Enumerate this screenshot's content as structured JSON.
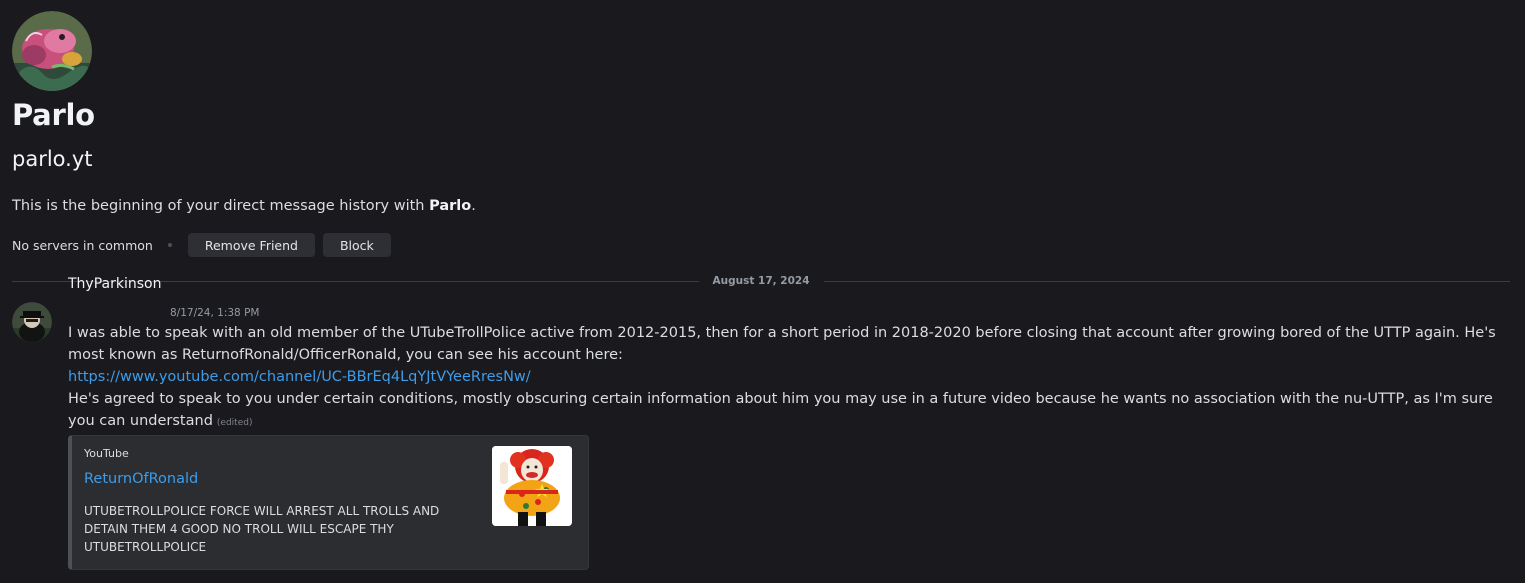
{
  "profile": {
    "display_name": "Parlo",
    "username": "parlo.yt",
    "intro_prefix": "This is the beginning of your direct message history with ",
    "intro_name": "Parlo",
    "intro_suffix": ".",
    "mutual_servers": "No servers in common",
    "remove_friend_label": "Remove Friend",
    "block_label": "Block"
  },
  "divider": {
    "date": "August 17, 2024"
  },
  "message": {
    "author": "ThyParkinson",
    "timestamp": "8/17/24, 1:38 PM",
    "line1": "I was able to speak with an old member of the UTubeTrollPolice active from 2012-2015, then for a short period in 2018-2020 before closing that account after growing bored of the UTTP again. He's most known as ReturnofRonald/OfficerRonald, you can see his account here:",
    "link": "https://www.youtube.com/channel/UC-BBrEq4LqYJtVYeeRresNw/",
    "line2": "He's agreed to speak to you under certain conditions, mostly obscuring certain information about him you may use in a future video because he wants no association with the nu-UTTP, as I'm sure you can understand",
    "edited_label": "(edited)"
  },
  "embed": {
    "provider": "YouTube",
    "title": "ReturnOfRonald",
    "description": "UTUBETROLLPOLICE FORCE WILL ARREST ALL TROLLS AND DETAIN THEM 4 GOOD NO TROLL WILL ESCAPE THY UTUBETROLLPOLICE"
  },
  "colors": {
    "background": "#1a1a1e",
    "link": "#3e9ce8",
    "button_bg": "#2e2f34",
    "embed_bg": "#2b2d31"
  }
}
